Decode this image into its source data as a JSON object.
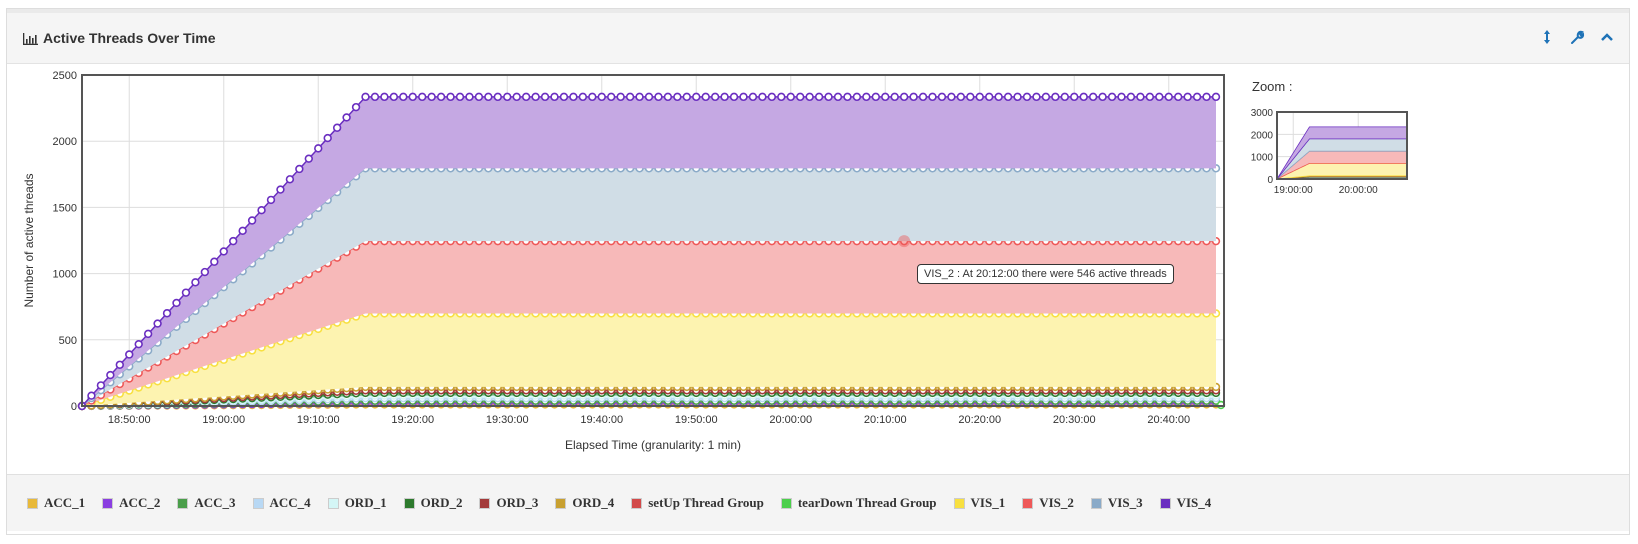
{
  "panel": {
    "title": "Active Threads Over Time",
    "title_icon": "bar-chart-icon",
    "header_icons": [
      {
        "name": "resize-vertical-icon",
        "glyph": "↕"
      },
      {
        "name": "wrench-icon",
        "glyph": "🔧"
      },
      {
        "name": "collapse-chevron-up-icon",
        "glyph": "⌃"
      }
    ]
  },
  "zoom_panel": {
    "label": "Zoom :",
    "y_ticks": [
      "0",
      "1000",
      "2000",
      "3000"
    ],
    "x_ticks": [
      "19:00:00",
      "20:00:00"
    ],
    "ylim": [
      0,
      3000
    ]
  },
  "tooltip": {
    "text": "VIS_2 : At 20:12:00 there were 546 active threads",
    "series": "VIS_2",
    "time": "20:12:00",
    "value": 546
  },
  "chart_data": {
    "type": "area",
    "stacked": true,
    "title": "Active Threads Over Time",
    "xlabel": "Elapsed Time (granularity: 1 min)",
    "ylabel": "Number of active threads",
    "ylim": [
      0,
      2500
    ],
    "y_ticks": [
      "0",
      "500",
      "1000",
      "1500",
      "2000",
      "2500"
    ],
    "x_ticks": [
      "18:50:00",
      "19:00:00",
      "19:10:00",
      "19:20:00",
      "19:30:00",
      "19:40:00",
      "19:50:00",
      "20:00:00",
      "20:10:00",
      "20:20:00",
      "20:30:00",
      "20:40:00"
    ],
    "x_start": "18:45:00",
    "x_end": "20:45:00",
    "granularity_min": 1,
    "ramp_end": "19:15:00",
    "grid": true,
    "legend_position": "bottom",
    "series": [
      {
        "name": "ACC_1",
        "color": "#e8b93a",
        "plateau": 12
      },
      {
        "name": "ACC_2",
        "color": "#8a3ee0",
        "plateau": 12
      },
      {
        "name": "ACC_3",
        "color": "#4a9e4a",
        "plateau": 15
      },
      {
        "name": "ACC_4",
        "color": "#b8d8f4",
        "plateau": 20
      },
      {
        "name": "ORD_1",
        "color": "#d4f6f6",
        "plateau": 20
      },
      {
        "name": "ORD_2",
        "color": "#2d7a2d",
        "plateau": 20
      },
      {
        "name": "ORD_3",
        "color": "#a33a3a",
        "plateau": 20
      },
      {
        "name": "ORD_4",
        "color": "#c8a030",
        "plateau": 25
      },
      {
        "name": "setUp Thread Group",
        "color": "#d24a4a",
        "plateau": 0
      },
      {
        "name": "tearDown Thread Group",
        "color": "#4ccf4c",
        "plateau": 0
      },
      {
        "name": "VIS_1",
        "color": "#f8e040",
        "plateau": 555
      },
      {
        "name": "VIS_2",
        "color": "#ee5858",
        "plateau": 546
      },
      {
        "name": "VIS_3",
        "color": "#8aaac8",
        "plateau": 550
      },
      {
        "name": "VIS_4",
        "color": "#6a2ec0",
        "plateau": 540
      }
    ],
    "fill_colors": {
      "VIS_1": "#fdf3b0",
      "VIS_2": "#f7b9b9",
      "VIS_3": "#d0dde6",
      "VIS_4": "#c5a8e3"
    }
  }
}
